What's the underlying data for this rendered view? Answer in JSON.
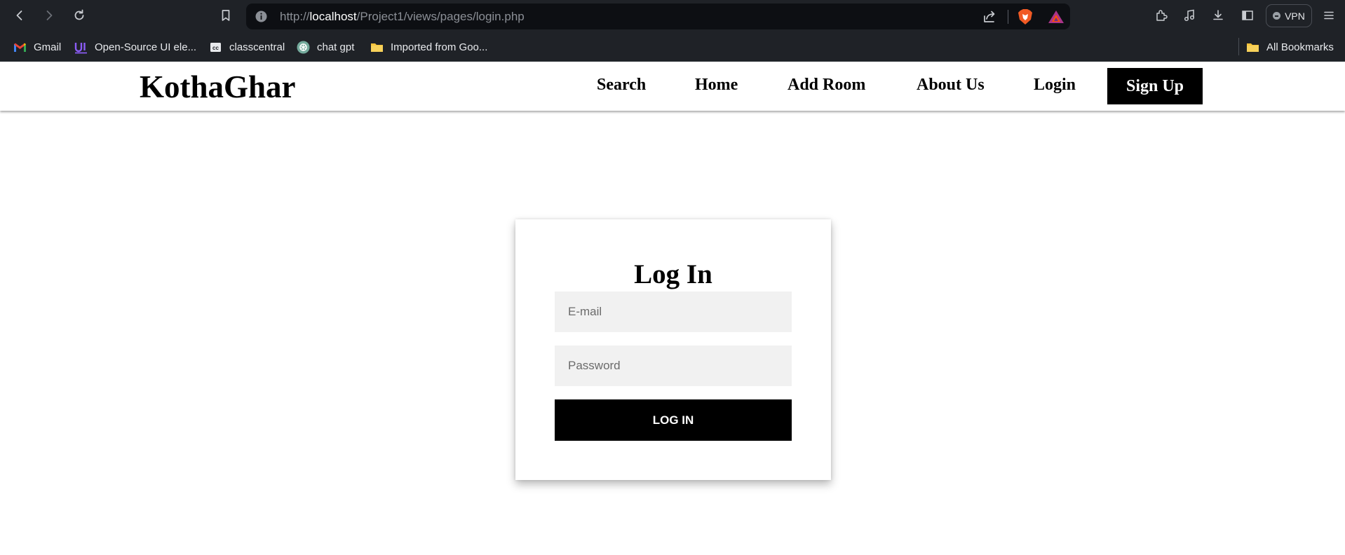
{
  "browser": {
    "url": {
      "prefix": "http://",
      "host": "localhost",
      "path": "/Project1/views/pages/login.php"
    },
    "vpn_label": "VPN",
    "bookmarks": [
      {
        "label": "Gmail",
        "icon": "gmail-icon"
      },
      {
        "label": "Open-Source UI ele...",
        "icon": "uiverse-icon"
      },
      {
        "label": "classcentral",
        "icon": "classcentral-icon"
      },
      {
        "label": "chat gpt",
        "icon": "chatgpt-icon"
      },
      {
        "label": "Imported from Goo...",
        "icon": "folder-icon"
      }
    ],
    "all_bookmarks_label": "All Bookmarks"
  },
  "site": {
    "brand": "KothaGhar",
    "nav": {
      "search": "Search",
      "home": "Home",
      "add_room": "Add Room",
      "about": "About Us",
      "login": "Login",
      "signup": "Sign Up"
    }
  },
  "login_form": {
    "title": "Log In",
    "email_placeholder": "E-mail",
    "password_placeholder": "Password",
    "submit_label": "LOG IN"
  },
  "colors": {
    "chrome_bg": "#1f2227",
    "url_bg": "#0d0f13",
    "page_bg": "#ffffff",
    "button_bg": "#000000",
    "input_bg": "#f1f1f1",
    "folder_yellow": "#f5c33b"
  }
}
